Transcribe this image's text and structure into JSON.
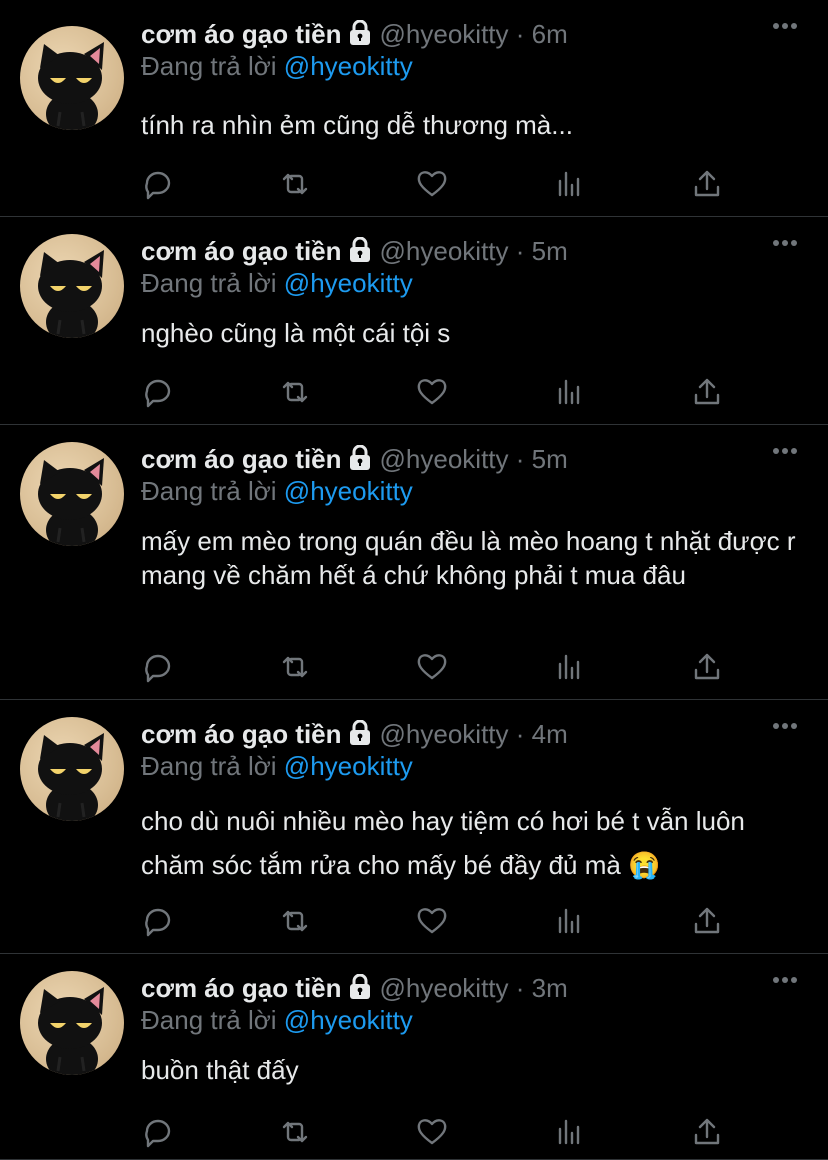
{
  "tweets": [
    {
      "name": "cơm áo gạo tiền",
      "handle": "@hyeokitty",
      "dot": "·",
      "time": "6m",
      "reply_prefix": "Đang trả lời",
      "reply_to": "@hyeokitty",
      "text": "tính ra nhìn ẻm cũng dễ thương mà...",
      "emoji": ""
    },
    {
      "name": "cơm áo gạo tiền",
      "handle": "@hyeokitty",
      "dot": "·",
      "time": "5m",
      "reply_prefix": "Đang trả lời",
      "reply_to": "@hyeokitty",
      "text": "nghèo cũng là một cái tội s",
      "emoji": ""
    },
    {
      "name": "cơm áo gạo tiền",
      "handle": "@hyeokitty",
      "dot": "·",
      "time": "5m",
      "reply_prefix": "Đang trả lời",
      "reply_to": "@hyeokitty",
      "text": "mấy em mèo trong quán đều là mèo hoang t nhặt được r mang về chăm hết á chứ không phải t mua đâu",
      "emoji": ""
    },
    {
      "name": "cơm áo gạo tiền",
      "handle": "@hyeokitty",
      "dot": "·",
      "time": "4m",
      "reply_prefix": "Đang trả lời",
      "reply_to": "@hyeokitty",
      "text": "cho dù nuôi nhiều mèo hay tiệm có hơi bé t vẫn luôn chăm sóc tắm rửa cho mấy bé đầy đủ mà",
      "emoji": "😭"
    },
    {
      "name": "cơm áo gạo tiền",
      "handle": "@hyeokitty",
      "dot": "·",
      "time": "3m",
      "reply_prefix": "Đang trả lời",
      "reply_to": "@hyeokitty",
      "text": "buồn thật đấy",
      "emoji": ""
    }
  ],
  "colors": {
    "background": "#000000",
    "text": "#e7e9ea",
    "secondary": "#71767b",
    "link": "#1d9bf0",
    "divider": "#2f3336"
  },
  "icons": [
    "lock-icon",
    "more-icon",
    "reply-icon",
    "retweet-icon",
    "like-icon",
    "analytics-icon",
    "share-icon",
    "cat-avatar"
  ]
}
